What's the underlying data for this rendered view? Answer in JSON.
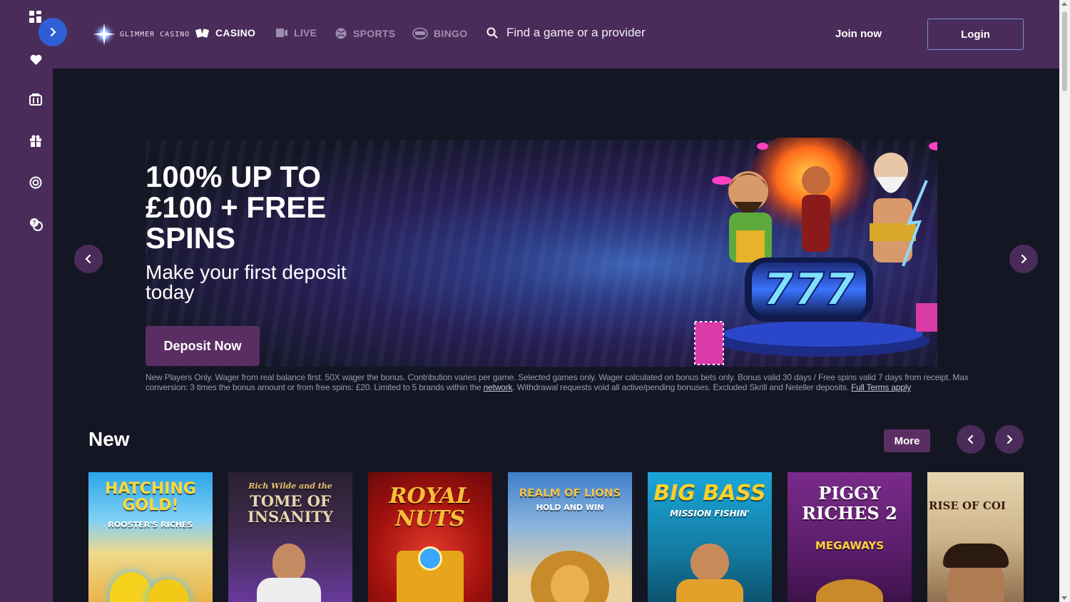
{
  "brand": {
    "logo_text": "GLIMMER CASINO"
  },
  "nav": [
    {
      "label": "CASINO",
      "icon": "cards-icon",
      "active": true
    },
    {
      "label": "LIVE",
      "icon": "live-dealer-icon",
      "active": false
    },
    {
      "label": "SPORTS",
      "icon": "sports-ball-icon",
      "active": false
    },
    {
      "label": "BINGO",
      "icon": "bingo-ball-icon",
      "active": false
    }
  ],
  "search": {
    "placeholder": "Find a game or a provider"
  },
  "auth": {
    "join_label": "Join now",
    "login_label": "Login"
  },
  "sidebar": {
    "icons": [
      "grid-icon",
      "heart-icon",
      "casino-building-icon",
      "gift-icon",
      "target-icon",
      "chat-support-icon"
    ]
  },
  "promo": {
    "headline": "100% UP TO £100 + FREE SPINS",
    "subhead": "Make your first deposit today",
    "cta_label": "Deposit Now",
    "terms_text": "New Players Only. Wager from real balance first. 50X wager the bonus. Contribution varies per game. Selected games only. Wager calculated on bonus bets only. Bonus valid 30 days / Free spins valid 7 days from receipt. Max conversion: 3 times the bonus amount or from free spins: £20. Limited to 5 brands within the",
    "terms_link_network": "network",
    "terms_text_2": ". Withdrawal requests void all active/pending bonuses. Excluded Skrill and Neteller deposits.",
    "terms_link_full": "Full Terms apply",
    "reel_text": "777"
  },
  "section_new": {
    "title": "New",
    "more_label": "More",
    "games": [
      {
        "title": "HATCHING GOLD!",
        "subtitle": "ROOSTER'S RICHES"
      },
      {
        "title": "TOME OF INSANITY",
        "subtitle": "Rich Wilde and the"
      },
      {
        "title": "ROYAL NUTS",
        "subtitle": ""
      },
      {
        "title": "REALM OF LIONS",
        "subtitle": "HOLD AND WIN"
      },
      {
        "title": "BIG BASS",
        "subtitle": "MISSION FISHIN'"
      },
      {
        "title": "PIGGY RICHES 2",
        "subtitle": "MEGAWAYS"
      },
      {
        "title": "RISE OF COI",
        "subtitle": ""
      }
    ]
  },
  "colors": {
    "shell": "#4a2c5a",
    "content_bg": "#151624",
    "accent_blue": "#2f5fd4",
    "button_purple": "#5a2e63"
  }
}
